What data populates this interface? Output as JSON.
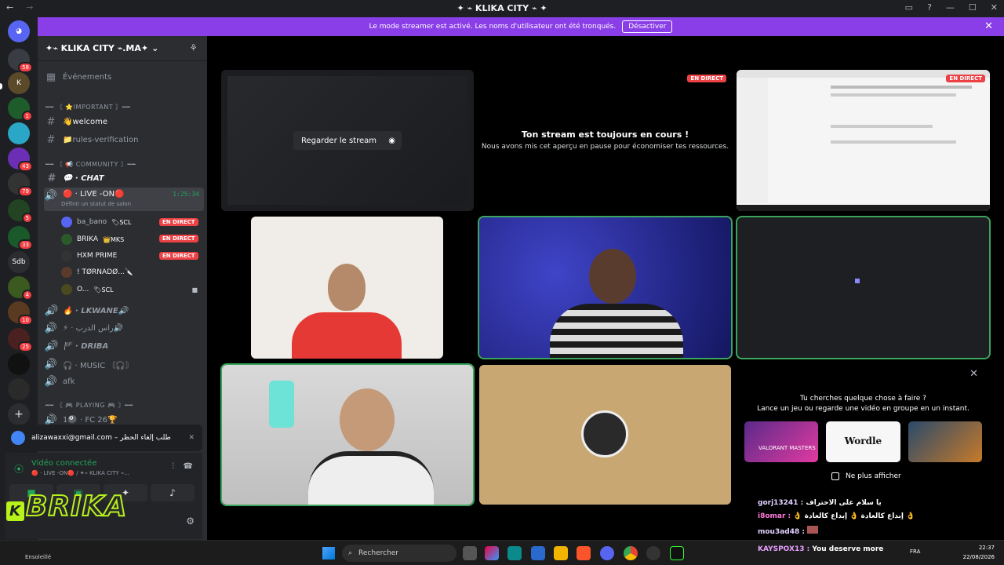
{
  "titlebar": {
    "title": "✦ ⌁ KLIKA CITY ⌁ ✦"
  },
  "banner": {
    "text": "Le mode streamer est activé. Les noms d'utilisateur ont été tronqués.",
    "button": "Désactiver"
  },
  "rail": {
    "badges": [
      "58",
      "1",
      "43",
      "79",
      "5",
      "33",
      "4",
      "10",
      "25"
    ],
    "sdb_label": "Sdb"
  },
  "server": {
    "name": "✦⌁ KLIKA CITY ⌁.MA✦"
  },
  "channels": {
    "events": "Événements",
    "cat_important": "━━ 〘 ⭐IMPORTANT 〙━━",
    "welcome": "👋welcome",
    "rules": "📁rules-verification",
    "cat_community": "━━ 〘 📢 COMMUNITY 〙━━",
    "chat": "💬 · CHAT",
    "live": "🔴 · LIVE -ON🔴",
    "live_timer": "1:25:34",
    "live_status": "Définir un statut de salon",
    "lkwane": "🔥 · LKWANE🔊",
    "ras": "⚡ · راس الدرب🔊",
    "driba": "🏴 · DRIBA",
    "music": "🎧 · MUSIC 〘🎧〙",
    "afk": "afk",
    "cat_playing": "━━ 〘 🎮 PLAYING 🎮 〙━━",
    "fc26": "1🎱 · FC 26🏆"
  },
  "members": [
    {
      "name": "ba_bano",
      "tag": "🏷SCL",
      "live": "EN DIRECT"
    },
    {
      "name": "BRIKA",
      "tag": "👑MKS",
      "live": "EN DIRECT"
    },
    {
      "name": "HXM PRIME",
      "tag": "",
      "live": "EN DIRECT"
    },
    {
      "name": "! TØRNADØ...🔪",
      "tag": "",
      "live": ""
    },
    {
      "name": "O...",
      "tag": "🏷SCL",
      "live": ""
    }
  ],
  "notification": {
    "text": "alizawaxxi@gmail.com – طلب إلغاء الحظر"
  },
  "voice": {
    "status": "Vidéo connectée",
    "channel": "🔴 · LIVE -ON🔴 / ✦⌁ KLIKA CITY ⌁..."
  },
  "overlay_logo": "BRIKA",
  "stage": {
    "watch_stream": "Regarder le stream",
    "paused_title": "Ton stream est toujours en cours !",
    "paused_sub": "Nous avons mis cet aperçu en pause pour économiser tes ressources.",
    "live_badge": "EN DIRECT",
    "activity_title": "Tu cherches quelque chose à faire ?",
    "activity_sub": "Lance un jeu ou regarde une vidéo en groupe en un instant.",
    "activity_cards": [
      "VALORANT MASTERS",
      "Wordle",
      ""
    ],
    "dont_show": "Ne plus afficher"
  },
  "chat_overlay": [
    {
      "user": "gorj13241 :",
      "msg": "يا سلام على الاحتراف"
    },
    {
      "user": "i8omar :",
      "msg": "👌 إبداع كالعادة 👌 إبداع كالعادة 👌"
    },
    {
      "user": "mou3ad48 :",
      "msg": ""
    },
    {
      "user": "KAYSPOX13 :",
      "msg": "You deserve more"
    }
  ],
  "taskbar": {
    "weather": "Ensoleillé",
    "search": "Rechercher",
    "lang": "FRA",
    "time": "22:37",
    "date": "22/08/2026"
  }
}
